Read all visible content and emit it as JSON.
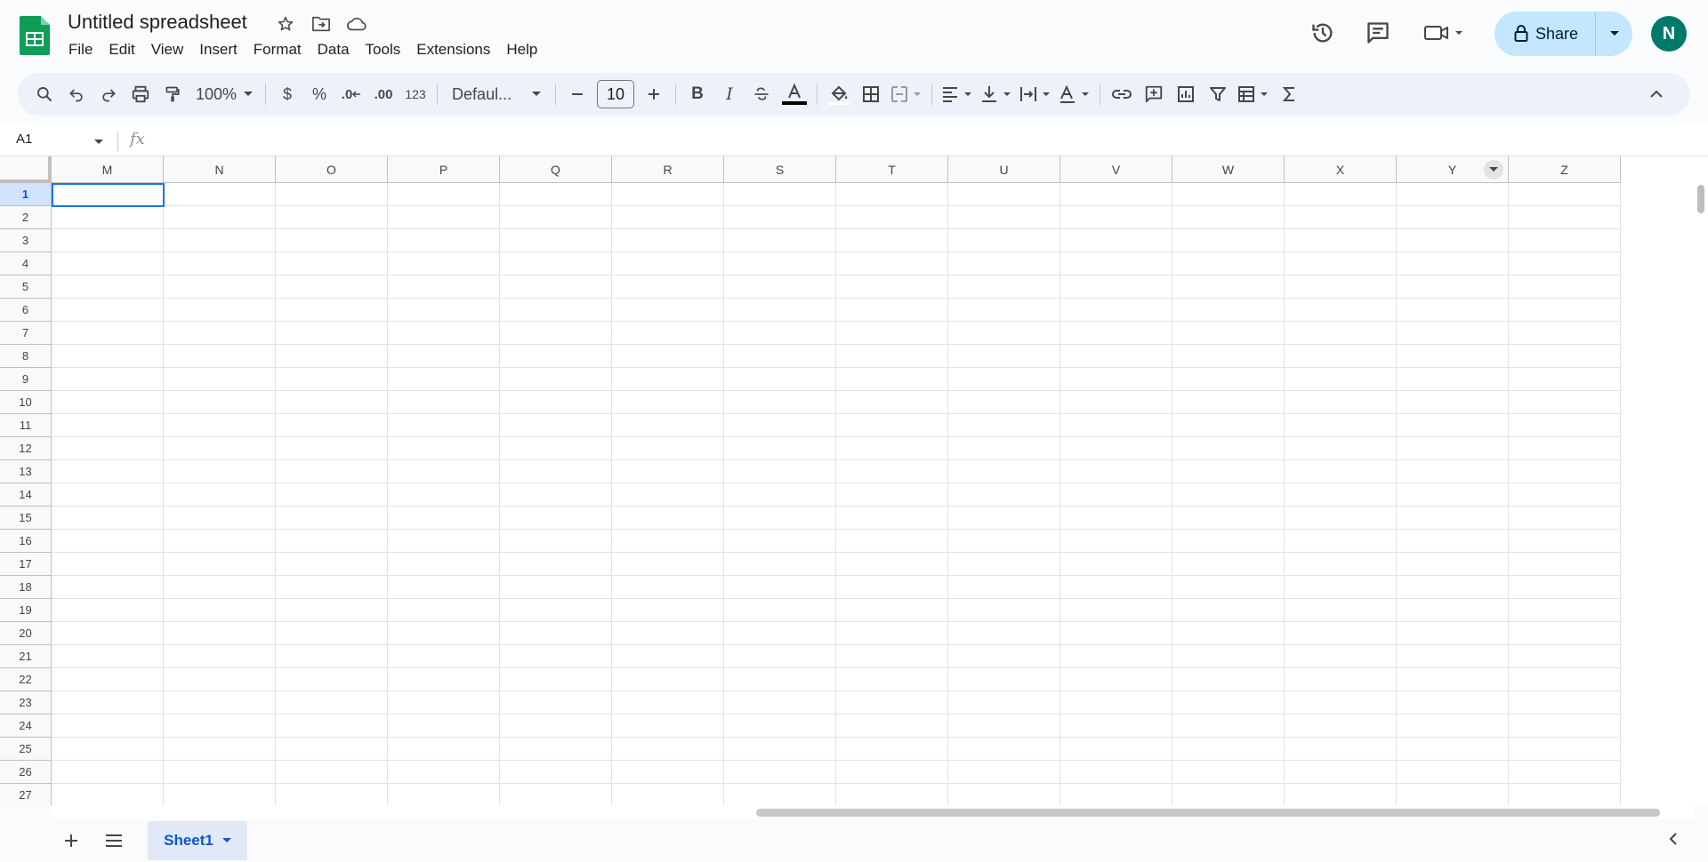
{
  "app": {
    "doc_title": "Untitled spreadsheet",
    "brand_color": "#0f9d58"
  },
  "menu": [
    "File",
    "Edit",
    "View",
    "Insert",
    "Format",
    "Data",
    "Tools",
    "Extensions",
    "Help"
  ],
  "share": {
    "label": "Share"
  },
  "avatar": {
    "initial": "N",
    "color": "#00796b"
  },
  "toolbar": {
    "zoom": "100%",
    "currency": "$",
    "percent": "%",
    "decrease_decimal": ".0",
    "increase_decimal": ".00",
    "number_format": "123",
    "font": "Defaul...",
    "font_size": "10",
    "bold": "B",
    "italic": "I"
  },
  "formula_bar": {
    "name_box": "A1",
    "fx": "fx"
  },
  "grid": {
    "columns": [
      "M",
      "N",
      "O",
      "P",
      "Q",
      "R",
      "S",
      "T",
      "U",
      "V",
      "W",
      "X",
      "Y",
      "Z"
    ],
    "rows": [
      "1",
      "2",
      "3",
      "4",
      "5",
      "6",
      "7",
      "8",
      "9",
      "10",
      "11",
      "12",
      "13",
      "14",
      "15",
      "16",
      "17",
      "18",
      "19",
      "20",
      "21",
      "22",
      "23",
      "24",
      "25",
      "26",
      "27"
    ],
    "selected_row": "1",
    "filter_column": "Y"
  },
  "sheets": [
    {
      "name": "Sheet1",
      "active": true
    }
  ]
}
